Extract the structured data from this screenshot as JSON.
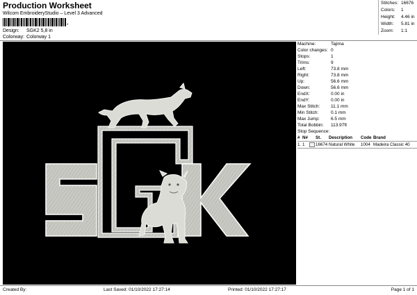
{
  "header": {
    "title": "Production Worksheet",
    "subtitle": "Wilcom EmbroideryStudio – Level 3 Advanced",
    "barcode_text": "*",
    "design_label": "Design:",
    "design_value": "SGK2 5,8 in",
    "colorway_label": "Colorway:",
    "colorway_value": "Colorway 1"
  },
  "stats": [
    {
      "label": "Stitches:",
      "value": "16676"
    },
    {
      "label": "Colors:",
      "value": "1"
    },
    {
      "label": "Height:",
      "value": "4.46 in"
    },
    {
      "label": "Width:",
      "value": "5.81 in"
    },
    {
      "label": "Zoom:",
      "value": "1:1"
    }
  ],
  "machine_info": [
    {
      "label": "Machine:",
      "value": "Tajima"
    },
    {
      "label": "Color changes:",
      "value": "0"
    },
    {
      "label": "Stops:",
      "value": "1"
    },
    {
      "label": "Trims:",
      "value": "9"
    },
    {
      "label": "Left:",
      "value": "73.8 mm"
    },
    {
      "label": "Right:",
      "value": "73.8 mm"
    },
    {
      "label": "Up:",
      "value": "56.6 mm"
    },
    {
      "label": "Down:",
      "value": "56.6 mm"
    },
    {
      "label": "EndX:",
      "value": "0.00 in"
    },
    {
      "label": "EndY:",
      "value": "0.00 in"
    },
    {
      "label": "Max Stitch:",
      "value": "11.1 mm"
    },
    {
      "label": "Min Stitch:",
      "value": "0.1 mm"
    },
    {
      "label": "Max Jump:",
      "value": "6.5 mm"
    },
    {
      "label": "Total Bobbin:",
      "value": "113.97ft"
    }
  ],
  "stop_sequence": {
    "title": "Stop Sequence:",
    "headers": [
      "#",
      "N#",
      "",
      "St.",
      "Description",
      "Code",
      "Brand"
    ],
    "rows": [
      {
        "num": "1.",
        "n": "1",
        "stitches": "16674",
        "description": "Natural White",
        "code": "1004",
        "brand": "Madeira Classic 40",
        "swatch": "#f4f4f4"
      }
    ]
  },
  "design": {
    "background": "#000000",
    "thread_color": "#c9c9c4",
    "letters": "SGK",
    "figures": [
      "leaping-dog",
      "standing-dog"
    ]
  },
  "footer": {
    "created": "Created By:",
    "last_saved": "Last Saved: 01/10/2022 17:27:14",
    "printed": "Printed: 01/10/2022 17:27:17",
    "page": "Page 1 of 1"
  }
}
